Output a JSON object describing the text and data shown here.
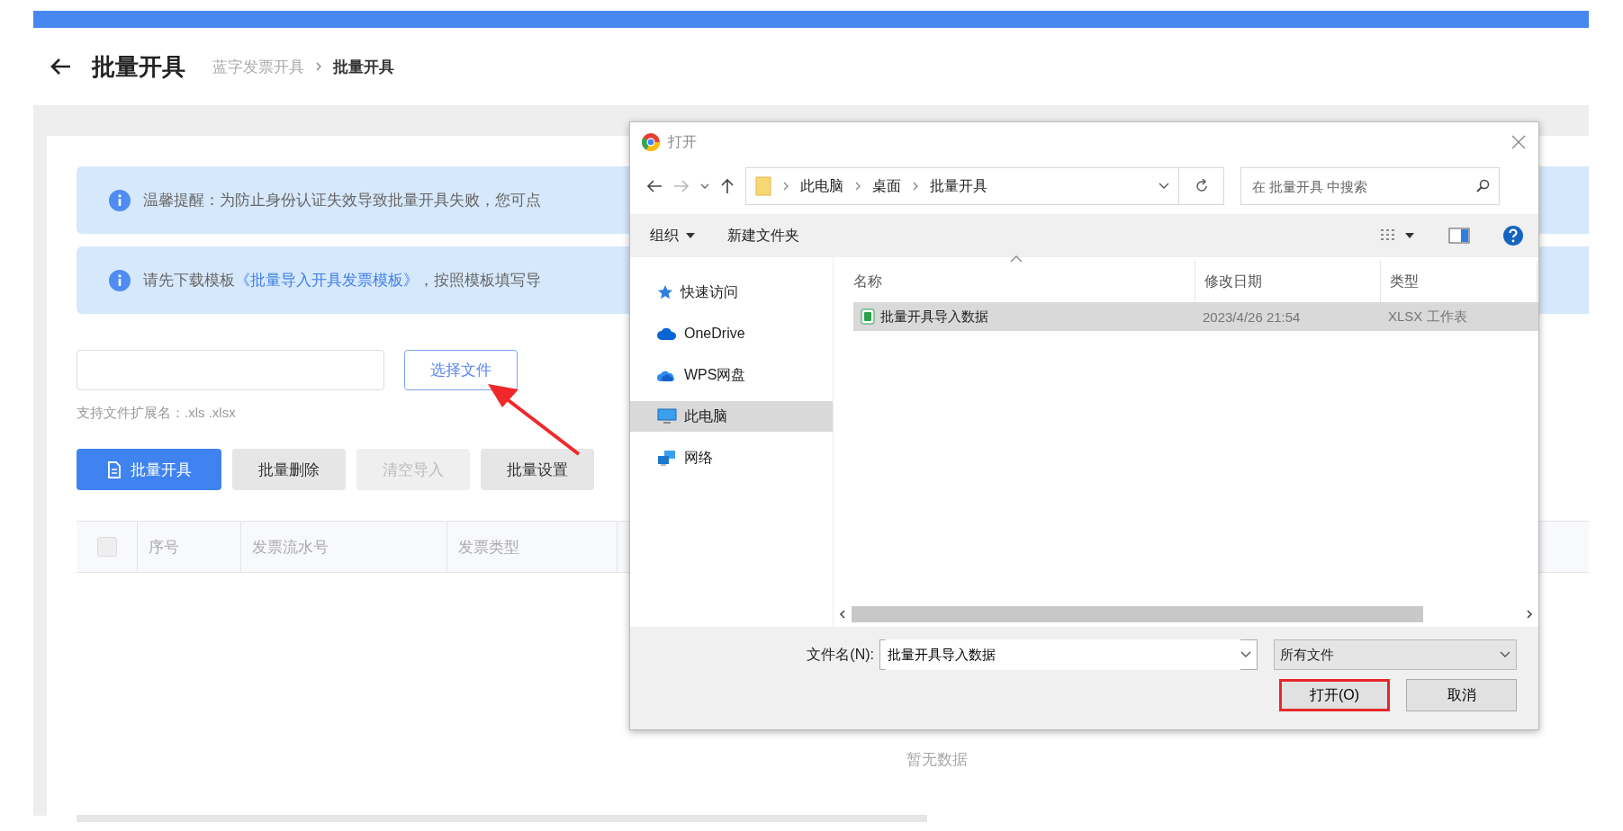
{
  "header": {
    "title": "批量开具",
    "breadcrumb": [
      {
        "label": "蓝字发票开具",
        "current": false
      },
      {
        "label": "批量开具",
        "current": true
      }
    ]
  },
  "alerts": [
    {
      "text": "温馨提醒：为防止身份认证失效导致批量开具失败，您可点"
    },
    {
      "text": "请先下载模板",
      "link": "《批量导入开具发票模板》",
      "text_after": "，按照模板填写导"
    }
  ],
  "upload": {
    "button": "选择文件",
    "hint": "支持文件扩展名：.xls .xlsx"
  },
  "actions": [
    {
      "label": "批量开具",
      "kind": "primary",
      "disabled": false
    },
    {
      "label": "批量删除",
      "kind": "default",
      "disabled": false
    },
    {
      "label": "清空导入",
      "kind": "default",
      "disabled": true
    },
    {
      "label": "批量设置",
      "kind": "default",
      "disabled": false
    }
  ],
  "table": {
    "select_all": {
      "checked": false
    },
    "columns": [
      "序号",
      "发票流水号",
      "发票类型"
    ],
    "empty_text": "暂无数据"
  },
  "dialog": {
    "title": "打开",
    "path": [
      "此电脑",
      "桌面",
      "批量开具"
    ],
    "search": {
      "placeholder": "在 批量开具 中搜索"
    },
    "toolbar": [
      {
        "label": "组织",
        "kind": "menu"
      },
      {
        "label": "新建文件夹",
        "kind": "plain"
      }
    ],
    "nav": [
      {
        "label": "快速访问",
        "kind": "star",
        "selected": false
      },
      {
        "label": "OneDrive",
        "kind": "cloud",
        "selected": false
      },
      {
        "label": "WPS网盘",
        "kind": "wps",
        "selected": false
      },
      {
        "label": "此电脑",
        "kind": "pc",
        "selected": true
      },
      {
        "label": "网络",
        "kind": "network",
        "selected": false
      }
    ],
    "columns": [
      "名称",
      "修改日期",
      "类型"
    ],
    "files": [
      {
        "name": "批量开具导入数据",
        "date": "2023/4/26 21:54",
        "type": "XLSX 工作表",
        "selected": true
      }
    ],
    "filename_label": "文件名(N):",
    "filename": "批量开具导入数据",
    "filetype": "所有文件",
    "buttons": [
      {
        "label": "打开(O)",
        "highlighted": true
      },
      {
        "label": "取消",
        "highlighted": false
      }
    ]
  }
}
